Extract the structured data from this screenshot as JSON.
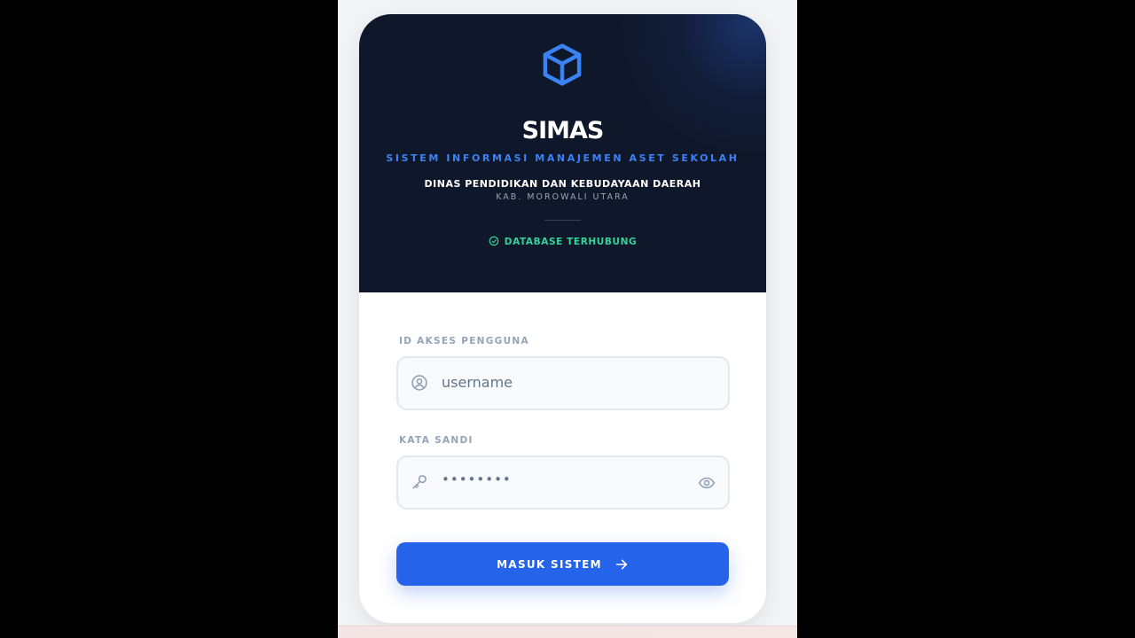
{
  "app": {
    "name": "SIMAS",
    "subtitle": "SISTEM INFORMASI MANAJEMEN ASET SEKOLAH",
    "logo_icon": "cube-icon"
  },
  "agency": {
    "name": "DINAS PENDIDIKAN DAN KEBUDAYAAN DAERAH",
    "region": "KAB. MOROWALI UTARA"
  },
  "status": {
    "label": "DATABASE TERHUBUNG",
    "icon": "check-circle-icon",
    "color": "#34d399"
  },
  "form": {
    "username": {
      "label": "ID AKSES PENGGUNA",
      "value": "username",
      "icon": "user-circle-icon"
    },
    "password": {
      "label": "KATA SANDI",
      "value": "••••••••",
      "icon": "key-icon",
      "toggle_icon": "eye-icon"
    },
    "submit": {
      "label": "MASUK SISTEM",
      "icon": "arrow-right-icon"
    }
  },
  "colors": {
    "accent": "#2563eb",
    "hero_bg": "#0f172a",
    "brand_blue": "#3b82f6"
  }
}
